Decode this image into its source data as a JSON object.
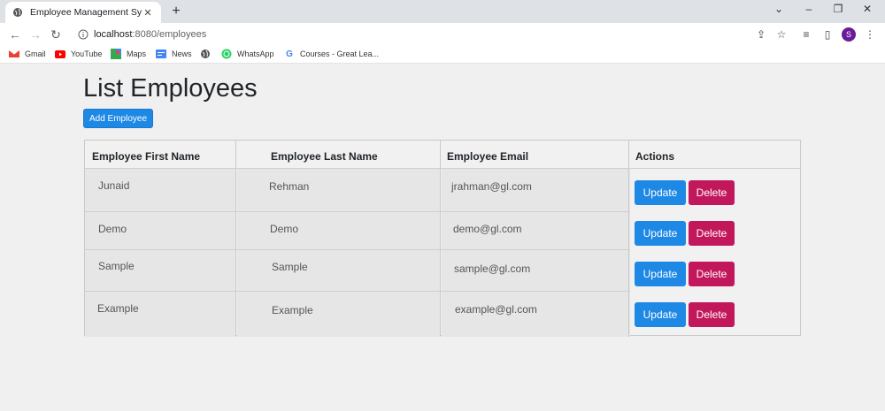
{
  "browser": {
    "tab_title": "Employee Management System",
    "url_host": "localhost",
    "url_path": ":8080/employees",
    "profile_initial": "S",
    "bookmarks": [
      {
        "label": "Gmail",
        "icon": "gmail-icon"
      },
      {
        "label": "YouTube",
        "icon": "youtube-icon"
      },
      {
        "label": "Maps",
        "icon": "maps-icon"
      },
      {
        "label": "News",
        "icon": "news-icon"
      },
      {
        "label": "",
        "icon": "globe-icon"
      },
      {
        "label": "WhatsApp",
        "icon": "whatsapp-icon"
      },
      {
        "label": "Courses - Great Lea...",
        "icon": "google-icon"
      }
    ]
  },
  "page": {
    "title": "List Employees",
    "add_button": "Add Employee"
  },
  "table": {
    "headers": [
      "Employee First Name",
      "Employee Last Name",
      "Employee Email",
      "Actions"
    ],
    "rows": [
      {
        "first": "Junaid",
        "last": "Rehman",
        "email": "jrahman@gl.com"
      },
      {
        "first": "Demo",
        "last": "Demo",
        "email": "demo@gl.com"
      },
      {
        "first": "Sample",
        "last": "Sample",
        "email": "sample@gl.com"
      },
      {
        "first": "Example",
        "last": "Example",
        "email": "example@gl.com"
      }
    ],
    "update_label": "Update",
    "delete_label": "Delete"
  },
  "colors": {
    "update": "#1e88e5",
    "delete": "#c2185b",
    "avatar": "#6a1b9a"
  }
}
